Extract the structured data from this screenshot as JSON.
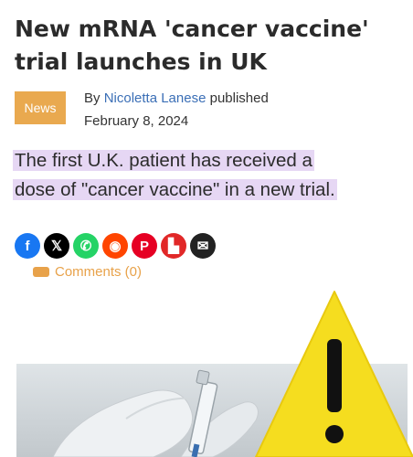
{
  "article": {
    "headline_line1": "New mRNA 'cancer vaccine'",
    "headline_line2": "trial launches in UK",
    "badge": "News",
    "byline_prefix": "By",
    "author": "Nicoletta Lanese",
    "byline_suffix": "published",
    "date": "February 8, 2024",
    "lede_line1": "The first U.K. patient has received a",
    "lede_line2": "dose of \"cancer vaccine\" in a new trial."
  },
  "share_buttons": [
    {
      "icon": "facebook-icon",
      "glyph": "f",
      "color": "#1877f2"
    },
    {
      "icon": "x-icon",
      "glyph": "𝕏",
      "color": "#000000"
    },
    {
      "icon": "whatsapp-icon",
      "glyph": "✆",
      "color": "#25d366"
    },
    {
      "icon": "reddit-icon",
      "glyph": "◉",
      "color": "#ff4500"
    },
    {
      "icon": "pinterest-icon",
      "glyph": "P",
      "color": "#e60023"
    },
    {
      "icon": "flipboard-icon",
      "glyph": "▙",
      "color": "#e12828"
    },
    {
      "icon": "email-icon",
      "glyph": "✉",
      "color": "#222222"
    }
  ],
  "comments": {
    "label": "Comments (0)"
  },
  "colors": {
    "badge": "#e9a94f",
    "author_link": "#3b6fb6",
    "lede_highlight": "#e6d7f4",
    "comments": "#e8a24a",
    "warning_yellow": "#f5dd1f"
  }
}
